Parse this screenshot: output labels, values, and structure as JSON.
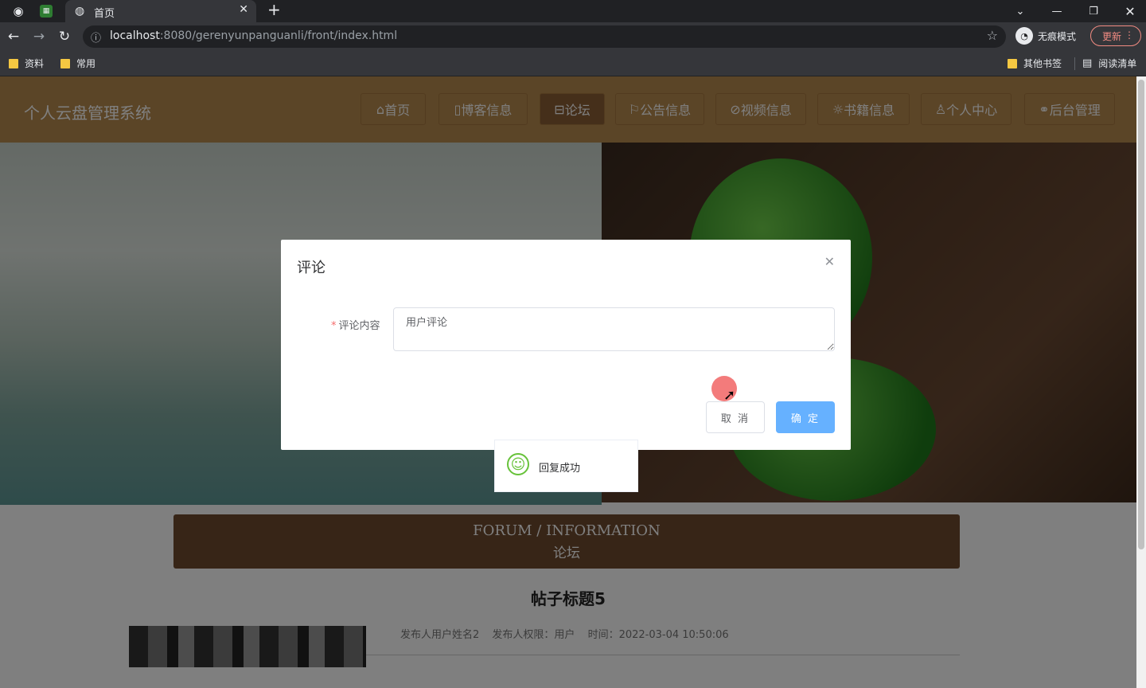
{
  "browser": {
    "tab_title": "首页",
    "url_host": "localhost",
    "url_rest": ":8080/gerenyunpanguanli/front/index.html",
    "incognito_label": "无痕模式",
    "update_label": "更新",
    "bookmarks": [
      "资料",
      "常用"
    ],
    "other_bookmarks": "其他书签",
    "reading_list": "阅读清单"
  },
  "site": {
    "title": "个人云盘管理系统",
    "menu": [
      {
        "icon": "home-icon",
        "glyph": "⌂",
        "label": "首页"
      },
      {
        "icon": "blog-icon",
        "glyph": "▯",
        "label": "博客信息"
      },
      {
        "icon": "forum-icon",
        "glyph": "⊟",
        "label": "论坛"
      },
      {
        "icon": "flag-icon",
        "glyph": "⚐",
        "label": "公告信息"
      },
      {
        "icon": "video-icon",
        "glyph": "⊘",
        "label": "视频信息"
      },
      {
        "icon": "book-icon",
        "glyph": "☼",
        "label": "书籍信息"
      },
      {
        "icon": "user-icon",
        "glyph": "♙",
        "label": "个人中心"
      },
      {
        "icon": "link-icon",
        "glyph": "⚭",
        "label": "后台管理"
      }
    ],
    "active_menu": "论坛"
  },
  "section": {
    "en": "FORUM / INFORMATION",
    "cn": "论坛"
  },
  "post": {
    "title": "帖子标题5",
    "author": "发布人用户姓名2",
    "role": "发布人权限：用户",
    "time": "时间：2022-03-04 10:50:06"
  },
  "dialog": {
    "title": "评论",
    "field_label": "评论内容",
    "field_value": "用户评论",
    "cancel": "取 消",
    "confirm": "确 定"
  },
  "toast": {
    "message": "回复成功"
  },
  "colors": {
    "header": "#b78a4f",
    "primary_button": "#66b1ff",
    "success": "#67c23a"
  }
}
